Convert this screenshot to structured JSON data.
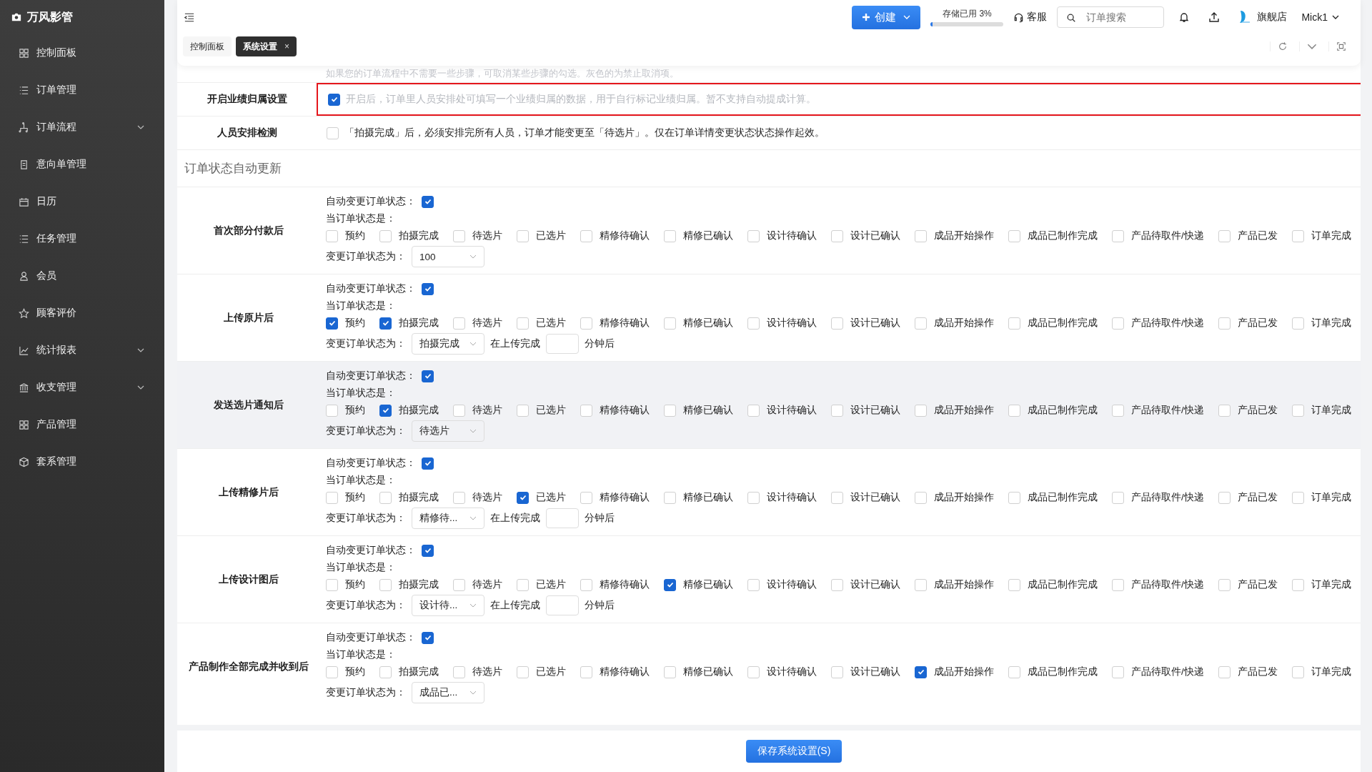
{
  "sidebar": {
    "brand": "万风影管",
    "items": [
      {
        "label": "控制面板",
        "expandable": false
      },
      {
        "label": "订单管理",
        "expandable": false
      },
      {
        "label": "订单流程",
        "expandable": true
      },
      {
        "label": "意向单管理",
        "expandable": false
      },
      {
        "label": "日历",
        "expandable": false
      },
      {
        "label": "任务管理",
        "expandable": false
      },
      {
        "label": "会员",
        "expandable": false
      },
      {
        "label": "顾客评价",
        "expandable": false
      },
      {
        "label": "统计报表",
        "expandable": true
      },
      {
        "label": "收支管理",
        "expandable": true
      },
      {
        "label": "产品管理",
        "expandable": false
      },
      {
        "label": "套系管理",
        "expandable": false
      }
    ]
  },
  "topbar": {
    "create_button": "创建",
    "storage": {
      "label": "存储已用 3%",
      "level": 0.03
    },
    "support": "客服",
    "search": {
      "placeholder": "订单搜索"
    },
    "store": "旗舰店",
    "user": "Mick1"
  },
  "tabs": [
    {
      "label": "控制面板",
      "selected": false
    },
    {
      "label": "系统设置",
      "selected": true,
      "close": "×"
    }
  ],
  "hint": "如果您的订单流程中不需要一些步骤，可取消某些步骤的勾选。灰色的为禁止取消项。",
  "settings": [
    {
      "label": "开启业绩归属设置",
      "checked": true,
      "disabled": true,
      "highlighted": true,
      "text": "开启后，订单里人员安排处可填写一个业绩归属的数据，用于自行标记业绩归属。暂不支持自动提成计算。"
    },
    {
      "label": "人员安排检测",
      "checked": false,
      "disabled": false,
      "highlighted": false,
      "text": "「拍摄完成」后，必须安排完所有人员，订单才能变更至「待选片」。仅在订单详情变更状态状态操作起效。"
    }
  ],
  "section_title": "订单状态自动更新",
  "groups": [
    {
      "title": "首次部分付款后",
      "highlighted": false,
      "auto_label": "自动变更订单状态：",
      "auto_checked": true,
      "current_label": "当订单状态是：",
      "target_label": "变更订单状态为：",
      "target": "100",
      "statuses": [
        {
          "label": "预约",
          "checked": false
        },
        {
          "label": "拍摄完成",
          "checked": false
        },
        {
          "label": "待选片",
          "checked": false
        },
        {
          "label": "已选片",
          "checked": false
        },
        {
          "label": "精修待确认",
          "checked": false
        },
        {
          "label": "精修已确认",
          "checked": false
        },
        {
          "label": "设计待确认",
          "checked": false
        },
        {
          "label": "设计已确认",
          "checked": false
        },
        {
          "label": "成品开始操作",
          "checked": false
        },
        {
          "label": "成品已制作完成",
          "checked": false
        },
        {
          "label": "产品待取件/快递",
          "checked": false
        },
        {
          "label": "产品已发",
          "checked": false
        },
        {
          "label": "订单完成",
          "checked": false
        }
      ]
    },
    {
      "title": "上传原片后",
      "highlighted": false,
      "auto_label": "自动变更订单状态：",
      "auto_checked": true,
      "current_label": "当订单状态是：",
      "target_label": "变更订单状态为：",
      "target": "拍摄完成",
      "delay": {
        "prefix": "在上传完成",
        "suffix": "分钟后"
      },
      "statuses": [
        {
          "label": "预约",
          "checked": true
        },
        {
          "label": "拍摄完成",
          "checked": true
        },
        {
          "label": "待选片",
          "checked": false
        },
        {
          "label": "已选片",
          "checked": false
        },
        {
          "label": "精修待确认",
          "checked": false
        },
        {
          "label": "精修已确认",
          "checked": false
        },
        {
          "label": "设计待确认",
          "checked": false
        },
        {
          "label": "设计已确认",
          "checked": false
        },
        {
          "label": "成品开始操作",
          "checked": false
        },
        {
          "label": "成品已制作完成",
          "checked": false
        },
        {
          "label": "产品待取件/快递",
          "checked": false
        },
        {
          "label": "产品已发",
          "checked": false
        },
        {
          "label": "订单完成",
          "checked": false
        }
      ]
    },
    {
      "title": "发送选片通知后",
      "highlighted": true,
      "auto_label": "自动变更订单状态：",
      "auto_checked": true,
      "current_label": "当订单状态是：",
      "target_label": "变更订单状态为：",
      "target": "待选片",
      "statuses": [
        {
          "label": "预约",
          "checked": false
        },
        {
          "label": "拍摄完成",
          "checked": true
        },
        {
          "label": "待选片",
          "checked": false
        },
        {
          "label": "已选片",
          "checked": false
        },
        {
          "label": "精修待确认",
          "checked": false
        },
        {
          "label": "精修已确认",
          "checked": false
        },
        {
          "label": "设计待确认",
          "checked": false
        },
        {
          "label": "设计已确认",
          "checked": false
        },
        {
          "label": "成品开始操作",
          "checked": false
        },
        {
          "label": "成品已制作完成",
          "checked": false
        },
        {
          "label": "产品待取件/快递",
          "checked": false
        },
        {
          "label": "产品已发",
          "checked": false
        },
        {
          "label": "订单完成",
          "checked": false
        }
      ]
    },
    {
      "title": "上传精修片后",
      "highlighted": false,
      "auto_label": "自动变更订单状态：",
      "auto_checked": true,
      "current_label": "当订单状态是：",
      "target_label": "变更订单状态为：",
      "target": "精修待...",
      "delay": {
        "prefix": "在上传完成",
        "suffix": "分钟后"
      },
      "statuses": [
        {
          "label": "预约",
          "checked": false
        },
        {
          "label": "拍摄完成",
          "checked": false
        },
        {
          "label": "待选片",
          "checked": false
        },
        {
          "label": "已选片",
          "checked": true
        },
        {
          "label": "精修待确认",
          "checked": false
        },
        {
          "label": "精修已确认",
          "checked": false
        },
        {
          "label": "设计待确认",
          "checked": false
        },
        {
          "label": "设计已确认",
          "checked": false
        },
        {
          "label": "成品开始操作",
          "checked": false
        },
        {
          "label": "成品已制作完成",
          "checked": false
        },
        {
          "label": "产品待取件/快递",
          "checked": false
        },
        {
          "label": "产品已发",
          "checked": false
        },
        {
          "label": "订单完成",
          "checked": false
        }
      ]
    },
    {
      "title": "上传设计图后",
      "highlighted": false,
      "auto_label": "自动变更订单状态：",
      "auto_checked": true,
      "current_label": "当订单状态是：",
      "target_label": "变更订单状态为：",
      "target": "设计待...",
      "delay": {
        "prefix": "在上传完成",
        "suffix": "分钟后"
      },
      "statuses": [
        {
          "label": "预约",
          "checked": false
        },
        {
          "label": "拍摄完成",
          "checked": false
        },
        {
          "label": "待选片",
          "checked": false
        },
        {
          "label": "已选片",
          "checked": false
        },
        {
          "label": "精修待确认",
          "checked": false
        },
        {
          "label": "精修已确认",
          "checked": true
        },
        {
          "label": "设计待确认",
          "checked": false
        },
        {
          "label": "设计已确认",
          "checked": false
        },
        {
          "label": "成品开始操作",
          "checked": false
        },
        {
          "label": "成品已制作完成",
          "checked": false
        },
        {
          "label": "产品待取件/快递",
          "checked": false
        },
        {
          "label": "产品已发",
          "checked": false
        },
        {
          "label": "订单完成",
          "checked": false
        }
      ]
    },
    {
      "title": "产品制作全部完成并收到后",
      "highlighted": false,
      "auto_label": "自动变更订单状态：",
      "auto_checked": true,
      "current_label": "当订单状态是：",
      "target_label": "变更订单状态为：",
      "target": "成品已...",
      "statuses": [
        {
          "label": "预约",
          "checked": false
        },
        {
          "label": "拍摄完成",
          "checked": false
        },
        {
          "label": "待选片",
          "checked": false
        },
        {
          "label": "已选片",
          "checked": false
        },
        {
          "label": "精修待确认",
          "checked": false
        },
        {
          "label": "精修已确认",
          "checked": false
        },
        {
          "label": "设计待确认",
          "checked": false
        },
        {
          "label": "设计已确认",
          "checked": false
        },
        {
          "label": "成品开始操作",
          "checked": true
        },
        {
          "label": "成品已制作完成",
          "checked": false
        },
        {
          "label": "产品待取件/快递",
          "checked": false
        },
        {
          "label": "产品已发",
          "checked": false
        },
        {
          "label": "订单完成",
          "checked": false
        }
      ]
    }
  ],
  "save_button": "保存系统设置(S)"
}
